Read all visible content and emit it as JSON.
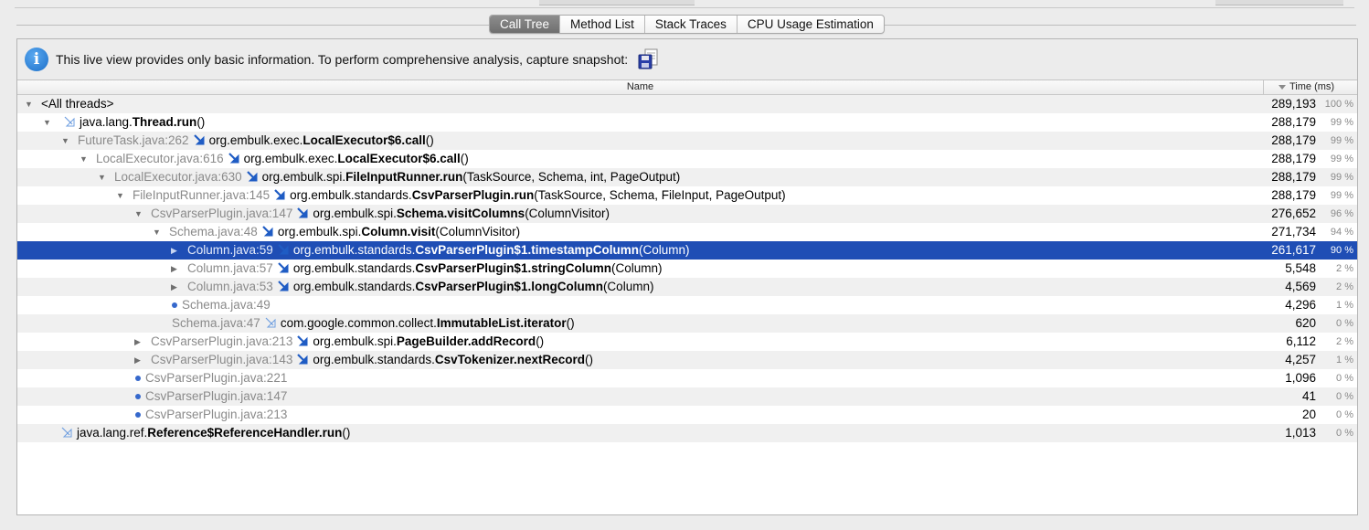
{
  "tabs": [
    {
      "label": "Call Tree",
      "active": true
    },
    {
      "label": "Method List",
      "active": false
    },
    {
      "label": "Stack Traces",
      "active": false
    },
    {
      "label": "CPU Usage Estimation",
      "active": false
    }
  ],
  "info": {
    "text": "This live view provides only basic information. To perform comprehensive analysis, capture snapshot:",
    "icon": "info-icon",
    "snapshot_icon": "floppy-disk-icon"
  },
  "columns": {
    "name": "Name",
    "time": "Time (ms)"
  },
  "colors": {
    "selection": "#1f4eb5",
    "accent": "#3568cc"
  },
  "rows": [
    {
      "depth": 0,
      "toggle": "expanded",
      "loc": "",
      "call": "",
      "pkg": "<All threads>",
      "method": "",
      "args": "",
      "time": "289,193",
      "pct": "100 %"
    },
    {
      "depth": 1,
      "toggle": "expanded",
      "loc": "",
      "call": "light",
      "pkg": "java.lang.",
      "method": "Thread.run",
      "args": "()",
      "time": "288,179",
      "pct": "99 %"
    },
    {
      "depth": 2,
      "toggle": "expanded",
      "loc": "FutureTask.java:262",
      "call": "dark",
      "pkg": "org.embulk.exec.",
      "method": "LocalExecutor$6.call",
      "args": "()",
      "time": "288,179",
      "pct": "99 %"
    },
    {
      "depth": 3,
      "toggle": "expanded",
      "loc": "LocalExecutor.java:616",
      "call": "dark",
      "pkg": "org.embulk.exec.",
      "method": "LocalExecutor$6.call",
      "args": "()",
      "time": "288,179",
      "pct": "99 %"
    },
    {
      "depth": 4,
      "toggle": "expanded",
      "loc": "LocalExecutor.java:630",
      "call": "dark",
      "pkg": "org.embulk.spi.",
      "method": "FileInputRunner.run",
      "args": "(TaskSource, Schema, int, PageOutput)",
      "time": "288,179",
      "pct": "99 %"
    },
    {
      "depth": 5,
      "toggle": "expanded",
      "loc": "FileInputRunner.java:145",
      "call": "dark",
      "pkg": "org.embulk.standards.",
      "method": "CsvParserPlugin.run",
      "args": "(TaskSource, Schema, FileInput, PageOutput)",
      "time": "288,179",
      "pct": "99 %"
    },
    {
      "depth": 6,
      "toggle": "expanded",
      "loc": "CsvParserPlugin.java:147",
      "call": "dark",
      "pkg": "org.embulk.spi.",
      "method": "Schema.visitColumns",
      "args": "(ColumnVisitor)",
      "time": "276,652",
      "pct": "96 %"
    },
    {
      "depth": 7,
      "toggle": "expanded",
      "loc": "Schema.java:48",
      "call": "dark",
      "pkg": "org.embulk.spi.",
      "method": "Column.visit",
      "args": "(ColumnVisitor)",
      "time": "271,734",
      "pct": "94 %"
    },
    {
      "depth": 8,
      "toggle": "collapsed",
      "loc": "Column.java:59",
      "call": "dark",
      "pkg": "org.embulk.standards.",
      "method": "CsvParserPlugin$1.timestampColumn",
      "args": "(Column)",
      "time": "261,617",
      "pct": "90 %",
      "selected": true
    },
    {
      "depth": 8,
      "toggle": "collapsed",
      "loc": "Column.java:57",
      "call": "dark",
      "pkg": "org.embulk.standards.",
      "method": "CsvParserPlugin$1.stringColumn",
      "args": "(Column)",
      "time": "5,548",
      "pct": "2 %"
    },
    {
      "depth": 8,
      "toggle": "collapsed",
      "loc": "Column.java:53",
      "call": "dark",
      "pkg": "org.embulk.standards.",
      "method": "CsvParserPlugin$1.longColumn",
      "args": "(Column)",
      "time": "4,569",
      "pct": "2 %"
    },
    {
      "depth": 8,
      "toggle": "bullet",
      "loc": "Schema.java:49",
      "call": "",
      "pkg": "",
      "method": "",
      "args": "",
      "time": "4,296",
      "pct": "1 %"
    },
    {
      "depth": 8,
      "toggle": "none",
      "loc": "Schema.java:47",
      "call": "light",
      "pkg": "com.google.common.collect.",
      "method": "ImmutableList.iterator",
      "args": "()",
      "time": "620",
      "pct": "0 %"
    },
    {
      "depth": 6,
      "toggle": "collapsed",
      "loc": "CsvParserPlugin.java:213",
      "call": "dark",
      "pkg": "org.embulk.spi.",
      "method": "PageBuilder.addRecord",
      "args": "()",
      "time": "6,112",
      "pct": "2 %"
    },
    {
      "depth": 6,
      "toggle": "collapsed",
      "loc": "CsvParserPlugin.java:143",
      "call": "dark",
      "pkg": "org.embulk.standards.",
      "method": "CsvTokenizer.nextRecord",
      "args": "()",
      "time": "4,257",
      "pct": "1 %"
    },
    {
      "depth": 6,
      "toggle": "bullet",
      "loc": "CsvParserPlugin.java:221",
      "call": "",
      "pkg": "",
      "method": "",
      "args": "",
      "time": "1,096",
      "pct": "0 %"
    },
    {
      "depth": 6,
      "toggle": "bullet",
      "loc": "CsvParserPlugin.java:147",
      "call": "",
      "pkg": "",
      "method": "",
      "args": "",
      "time": "41",
      "pct": "0 %"
    },
    {
      "depth": 6,
      "toggle": "bullet",
      "loc": "CsvParserPlugin.java:213",
      "call": "",
      "pkg": "",
      "method": "",
      "args": "",
      "time": "20",
      "pct": "0 %"
    },
    {
      "depth": 1,
      "toggle": "none",
      "loc": "",
      "call": "light",
      "pkg": "java.lang.ref.",
      "method": "Reference$ReferenceHandler.run",
      "args": "()",
      "time": "1,013",
      "pct": "0 %"
    }
  ]
}
